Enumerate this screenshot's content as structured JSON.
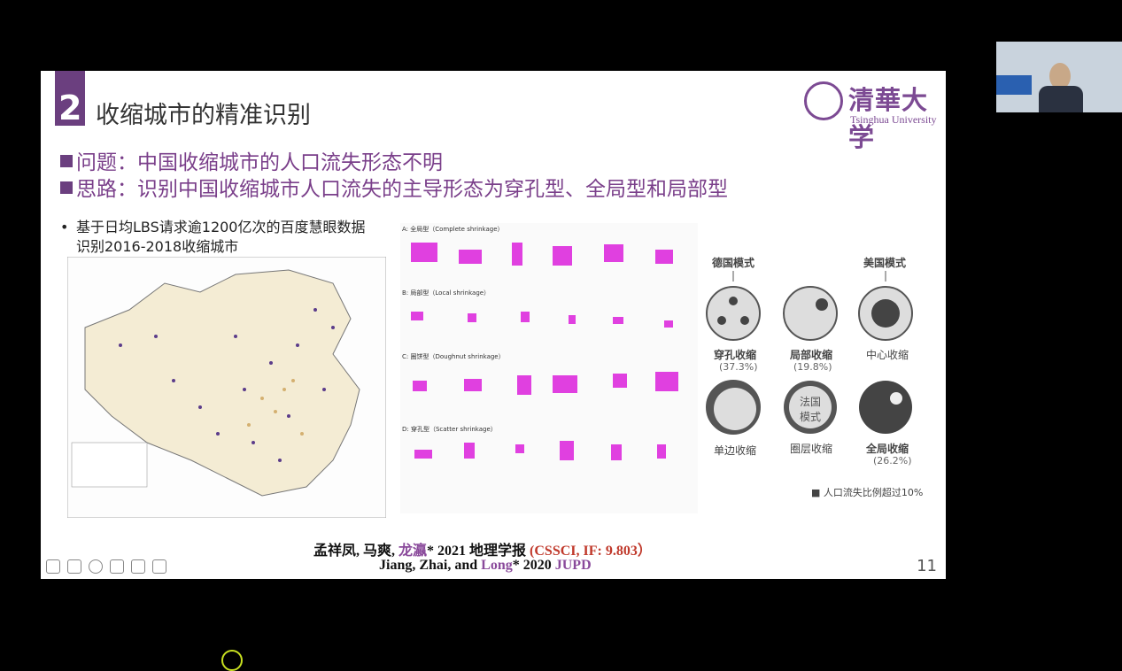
{
  "slide": {
    "section_number": "2",
    "title": "收缩城市的精准识别",
    "logo_cn": "清華大学",
    "logo_en": "Tsinghua University",
    "problem": "问题：中国收缩城市的人口流失形态不明",
    "approach": "思路：识别中国收缩城市人口流失的主导形态为穿孔型、全局型和局部型",
    "bullet": "基于日均LBS请求逾1200亿次的百度慧眼数据识别2016-2018收缩城市",
    "panels": {
      "a": "A: 全局型（Complete shrinkage）",
      "b": "B: 局部型（Local shrinkage）",
      "c": "C: 圈饼型（Doughnut shrinkage）",
      "d": "D: 穿孔型（Scatter shrinkage）"
    },
    "diagrams": {
      "german_model": "德国模式",
      "us_model": "美国模式",
      "french_model": "法国模式",
      "perforated": "穿孔收缩",
      "perforated_pct": "(37.3%)",
      "local": "局部收缩",
      "local_pct": "(19.8%)",
      "center": "中心收缩",
      "one_side": "单边收缩",
      "ring": "圈层收缩",
      "global": "全局收缩",
      "global_pct": "(26.2%)",
      "legend": "人口流失比例超过10%"
    },
    "citation1": {
      "authors": "孟祥凤, 马爽, ",
      "long": "龙瀛",
      "rest": "* 2021 地理学报 ",
      "index": "(CSSCI, IF: 9.803）"
    },
    "citation2": {
      "authors": "Jiang, Zhai, and ",
      "long": "Long",
      "rest": "* 2020 ",
      "journal": "JUPD"
    },
    "page_number": "11"
  },
  "colors": {
    "accent": "#6b3f7f",
    "magenta": "#e040e0",
    "dark_circle": "#4a4a4a"
  }
}
